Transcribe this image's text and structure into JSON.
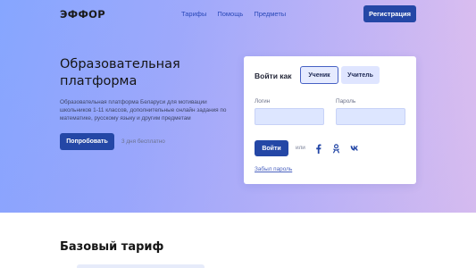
{
  "header": {
    "logo": "ЭФФОР",
    "nav": [
      "Тарифы",
      "Помощь",
      "Предметы"
    ],
    "register_label": "Регистрация"
  },
  "hero": {
    "title": "Образовательная платформа",
    "description": "Образовательная платформа Беларуси для мотивации школьников 1-11 классов, дополнительные онлайн задания по математике, русскому языку и другим предметам",
    "try_label": "Попробовать",
    "free_note": "3 дня бесплатно"
  },
  "login_card": {
    "title": "Войти как",
    "roles": [
      "Ученик",
      "Учитель"
    ],
    "selected_role": "Ученик",
    "login_label": "Логин",
    "login_value": "",
    "password_label": "Пароль",
    "password_value": "",
    "submit_label": "Войти",
    "or_text": "или",
    "social": [
      "facebook-icon",
      "odnoklassniki-icon",
      "vk-icon"
    ],
    "forgot_label": "Забыл пароль"
  },
  "tariff": {
    "title": "Базовый тариф"
  },
  "colors": {
    "accent": "#2447a6",
    "link": "#2a49b8",
    "field_bg": "#dde6ff"
  }
}
